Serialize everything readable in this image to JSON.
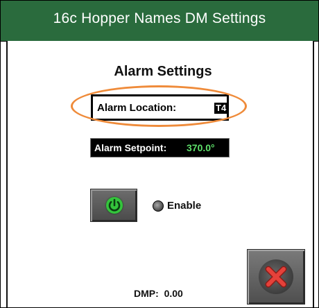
{
  "window": {
    "title": "16c Hopper Names DM Settings"
  },
  "alarm": {
    "heading": "Alarm Settings",
    "location_label": "Alarm Location:",
    "location_value": "T4",
    "setpoint_label": "Alarm Setpoint:",
    "setpoint_value": "370.0°",
    "enable_label": "Enable"
  },
  "status": {
    "dmp_label": "DMP:",
    "dmp_value": "0.00"
  },
  "icons": {
    "power": "power-icon",
    "close": "close-icon",
    "enable_indicator": "led-indicator"
  },
  "colors": {
    "title_bar": "#2a6b3d",
    "highlight_ring": "#ef8b3a",
    "setpoint_value": "#5ee06a",
    "power_icon": "#34c43c",
    "close_icon": "#e5413a"
  }
}
